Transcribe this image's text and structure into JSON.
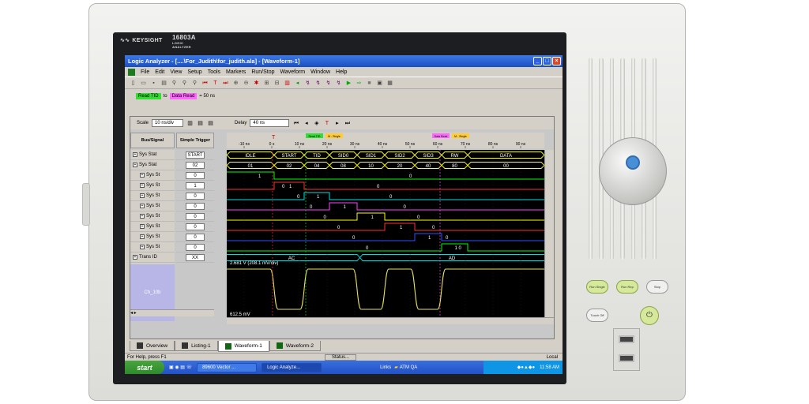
{
  "device": {
    "brand": "KEYSIGHT",
    "model": "16803A",
    "subtitle": "LOGIC ANALYZER"
  },
  "window": {
    "title": "Logic Analyzer - [....\\For_Judith\\for_judith.ala] - [Waveform-1]"
  },
  "menu": [
    "File",
    "Edit",
    "View",
    "Setup",
    "Tools",
    "Markers",
    "Run/Stop",
    "Waveform",
    "Window",
    "Help"
  ],
  "marker_bar": {
    "from": "Read TID",
    "to_word": "to",
    "to": "Data Read",
    "value": "= 50 ns"
  },
  "controls": {
    "scale_label": "Scale",
    "scale_value": "10 ns/div",
    "delay_label": "Delay",
    "delay_value": "40 ns"
  },
  "columns": {
    "bus": "Bus/Signal",
    "trigger": "Simple Trigger"
  },
  "signals": [
    {
      "name": "Sys Stat",
      "trigger": "START"
    },
    {
      "name": "Sys Stat",
      "trigger": "02"
    },
    {
      "name": "Sys St",
      "trigger": "0"
    },
    {
      "name": "Sys St",
      "trigger": "1"
    },
    {
      "name": "Sys St",
      "trigger": "0"
    },
    {
      "name": "Sys St",
      "trigger": "0"
    },
    {
      "name": "Sys St",
      "trigger": "0"
    },
    {
      "name": "Sys St",
      "trigger": "0"
    },
    {
      "name": "Sys St",
      "trigger": "0"
    },
    {
      "name": "Sys St",
      "trigger": "0"
    },
    {
      "name": "Trans ID",
      "trigger": "XX"
    }
  ],
  "analog_label": "Ch_10b",
  "time_ticks": [
    "-10 ns",
    "0 s",
    "10 ns",
    "20 ns",
    "30 ns",
    "40 ns",
    "50 ns",
    "60 ns",
    "70 ns",
    "80 ns",
    "90 ns"
  ],
  "markers_top": [
    "Read TID",
    "M - Single",
    "Data Read",
    "M - Single"
  ],
  "bus_states": [
    "IDLE",
    "START",
    "TID",
    "SID0",
    "SID1",
    "SID2",
    "SID3",
    "RW",
    "DATA"
  ],
  "bus_values": [
    "01",
    "02",
    "04",
    "08",
    "10",
    "20",
    "40",
    "80",
    "00"
  ],
  "trans_values": [
    "AC",
    "AD"
  ],
  "analog_texts": {
    "top": "2.681 V  (208.1 mV/div)",
    "bottom": "612.5 mV"
  },
  "tabs": [
    "Overview",
    "Listing-1",
    "Waveform-1",
    "Waveform-2"
  ],
  "status": {
    "help": "For Help, press F1",
    "center": "Status...",
    "right": "Local"
  },
  "taskbar": {
    "start": "start",
    "items": [
      "89600 Vector ...",
      "Logic Analyze..."
    ],
    "links": "Links",
    "folder": "ATM QA",
    "time": "11:58 AM"
  },
  "panel_buttons": {
    "run_single": "Run Single",
    "run_rep": "Run Rep",
    "stop": "Stop",
    "touch_off": "Touch Off"
  },
  "colors": {
    "bus": "#ffff00",
    "green": "#00ff00",
    "red": "#ff3030",
    "blue": "#3050ff",
    "magenta": "#ff40ff",
    "cyan": "#00e0e0",
    "analog": "#e8e060"
  }
}
